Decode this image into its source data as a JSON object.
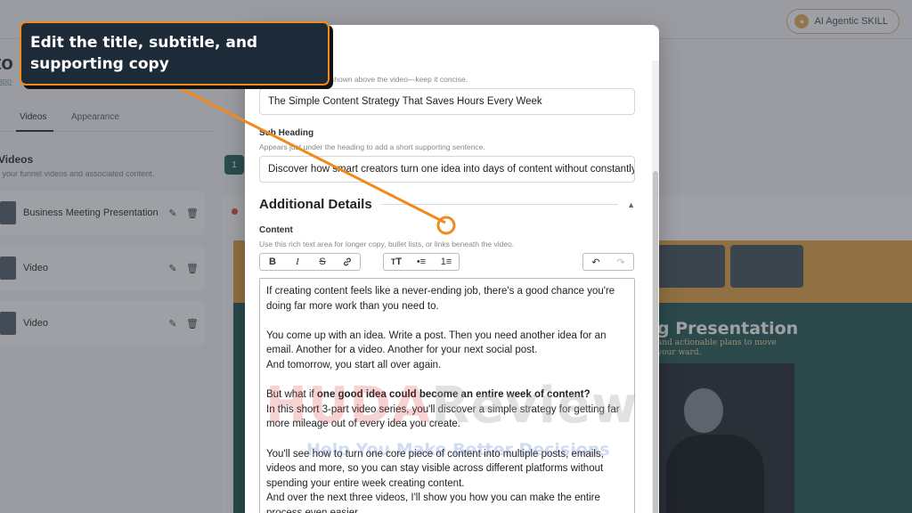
{
  "app": {
    "skill_button": "AI Agentic SKILL",
    "page_title": "to",
    "page_subtitle": "app",
    "tabs": [
      {
        "label": "Videos"
      },
      {
        "label": "Appearance"
      }
    ],
    "videos_heading": "Videos",
    "videos_subheading": "l your funnel videos and associated content.",
    "video_items": [
      {
        "name": "Business Meeting Presentation"
      },
      {
        "name": "Video"
      },
      {
        "name": "Video"
      }
    ],
    "page_number": "1",
    "preview": {
      "title": "g Presentation",
      "subtitle": "and actionable plans to move your ward."
    }
  },
  "modal": {
    "heading_hint": "shown above the video—keep it concise.",
    "heading_value": "The Simple Content Strategy That Saves Hours Every Week",
    "sub_heading_label": "Sub Heading",
    "sub_heading_hint": "Appears just under the heading to add a short supporting sentence.",
    "sub_heading_value": "Discover how smart creators turn one idea into days of content without constantly",
    "section_title": "Additional Details",
    "content_label": "Content",
    "content_hint": "Use this rich text area for longer copy, bullet lists, or links beneath the video.",
    "toolbar": {
      "bold": "B",
      "italic": "I",
      "strike": "S",
      "heading": "T",
      "bullet_list": "•≡",
      "ordered_list": "1≡",
      "undo": "↶",
      "redo": "↷"
    },
    "content": {
      "p1": "If creating content feels like a never-ending job, there's a good chance you're doing far more work than you need to.",
      "p2a": "You come up with an idea. Write a post. Then you need another idea for an email. Another for a video. Another for your next social post.",
      "p2b": "And tomorrow, you start all over again.",
      "p3_prefix": "But what if ",
      "p3_bold": "one good idea could become an entire week of content?",
      "p3b": "In this short 3-part video series, you'll discover a simple strategy for getting far more mileage out of every idea you create.",
      "p4": "You'll see how to turn one core piece of content into multiple posts, emails, videos and more, so you can stay visible across different platforms without spending your entire week creating content.",
      "p5": "And over the next three videos, I'll show you how you can make the entire process even easier."
    }
  },
  "watermark": {
    "brand_red": "HUDA",
    "brand_gray": "Review",
    "tagline": "Help You Make Better Decisions"
  },
  "callout": {
    "text": "Edit the title, subtitle, and supporting copy"
  },
  "colors": {
    "callout_bg": "#1d2a38",
    "callout_border": "#f08a1c",
    "pointer": "#f08a1c",
    "accent_green": "#2b6b5f"
  }
}
